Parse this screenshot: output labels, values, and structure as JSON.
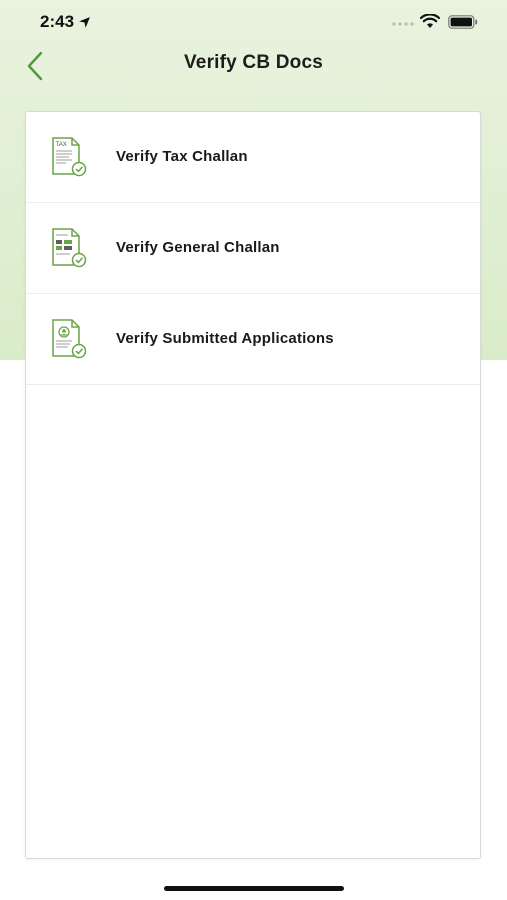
{
  "status_bar": {
    "time": "2:43"
  },
  "header": {
    "title": "Verify CB Docs"
  },
  "menu": {
    "items": [
      {
        "label": "Verify Tax Challan",
        "icon": "tax-document-check-icon"
      },
      {
        "label": "Verify General Challan",
        "icon": "general-challan-document-check-icon"
      },
      {
        "label": "Verify Submitted Applications",
        "icon": "application-document-check-icon"
      }
    ]
  },
  "colors": {
    "accent": "#5a9a3c",
    "header_bg": "#e3f0d6"
  },
  "icon_text": {
    "tax": "TAX"
  }
}
